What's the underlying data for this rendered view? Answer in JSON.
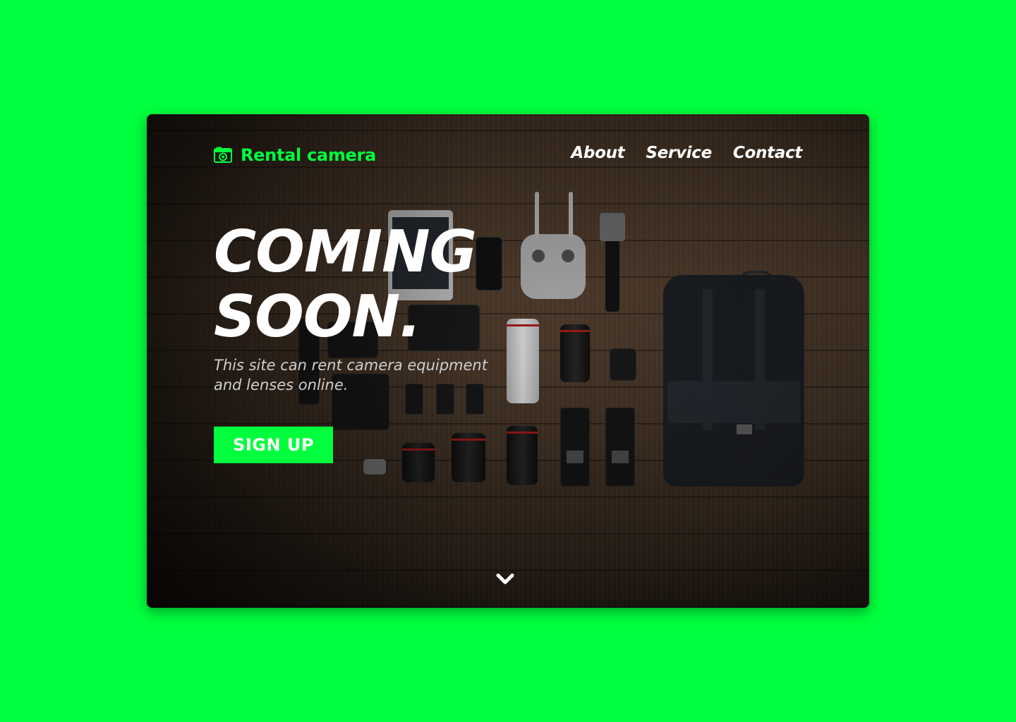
{
  "colors": {
    "page_background": "#00ff3d",
    "accent": "#00ff3d",
    "text_primary": "#ffffff",
    "text_secondary": "#cfcfcf"
  },
  "header": {
    "logo_icon": "camera-icon",
    "logo_text": "Rental camera",
    "nav": [
      {
        "label": "About"
      },
      {
        "label": "Service"
      },
      {
        "label": "Contact"
      }
    ]
  },
  "hero": {
    "title_line1": "COMING",
    "title_line2": "SOON.",
    "subtitle": "This site can rent camera equipment and lenses online.",
    "cta_label": "SIGN UP",
    "scroll_icon": "chevron-down-icon"
  },
  "background_image": "top-down photo of camera gear, lenses, drone controller and backpack on wooden floor"
}
